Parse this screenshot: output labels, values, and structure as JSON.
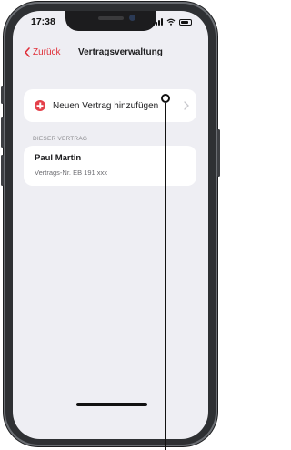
{
  "status_bar": {
    "time": "17:38",
    "icons": [
      "signal-icon",
      "wifi-icon",
      "battery-icon"
    ]
  },
  "nav": {
    "back_label": "Zurück",
    "back_icon": "chevron-left-icon",
    "title": "Vertragsverwaltung"
  },
  "add_contract": {
    "label": "Neuen Vertrag hinzufügen",
    "icon": "plus-circle-icon",
    "chevron_icon": "chevron-right-icon"
  },
  "section": {
    "header": "DIESER VERTRAG",
    "contract": {
      "name": "Paul Martin",
      "number": "Vertrags-Nr. EB 191 xxx"
    }
  },
  "colors": {
    "accent": "#e0303a",
    "plus": "#e4404a",
    "background": "#eeeef3",
    "frame": "#2e3033"
  }
}
